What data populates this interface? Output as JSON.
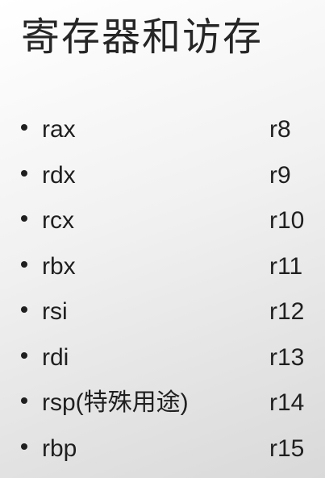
{
  "title": "寄存器和访存",
  "registers": [
    {
      "left": "rax",
      "right": "r8"
    },
    {
      "left": "rdx",
      "right": "r9"
    },
    {
      "left": "rcx",
      "right": "r10"
    },
    {
      "left": "rbx",
      "right": "r11"
    },
    {
      "left": "rsi",
      "right": "r12"
    },
    {
      "left": "rdi",
      "right": "r13"
    },
    {
      "left": "rsp(特殊用途)",
      "right": "r14"
    },
    {
      "left": "rbp",
      "right": "r15"
    }
  ]
}
